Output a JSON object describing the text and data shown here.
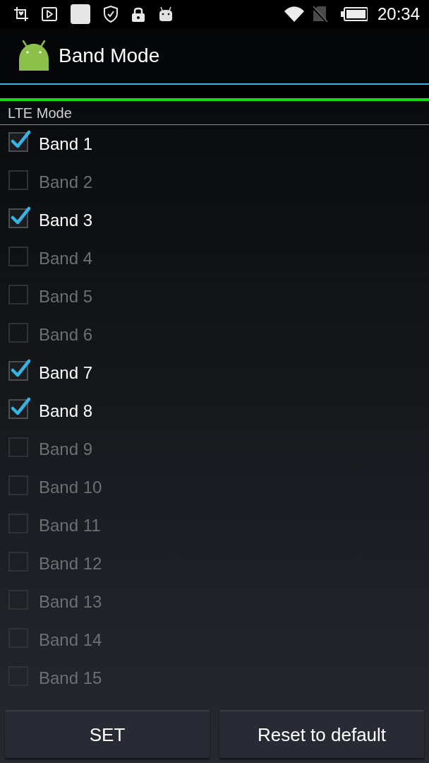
{
  "status_bar": {
    "notification_icons": [
      {
        "kind": "crop"
      },
      {
        "kind": "play"
      },
      {
        "kind": "square"
      },
      {
        "kind": "shield"
      },
      {
        "kind": "lock"
      },
      {
        "kind": "robot"
      }
    ],
    "system_icons": [
      {
        "kind": "wifi"
      },
      {
        "kind": "nosim"
      },
      {
        "kind": "battery"
      }
    ],
    "time": "20:34"
  },
  "app_bar": {
    "title": "Band Mode"
  },
  "section": {
    "title": "LTE Mode"
  },
  "bands": [
    {
      "label": "Band 1",
      "checked": true,
      "disabled": false
    },
    {
      "label": "Band 2",
      "checked": false,
      "disabled": true
    },
    {
      "label": "Band 3",
      "checked": true,
      "disabled": false
    },
    {
      "label": "Band 4",
      "checked": false,
      "disabled": true
    },
    {
      "label": "Band 5",
      "checked": false,
      "disabled": true
    },
    {
      "label": "Band 6",
      "checked": false,
      "disabled": true
    },
    {
      "label": "Band 7",
      "checked": true,
      "disabled": false
    },
    {
      "label": "Band 8",
      "checked": true,
      "disabled": false
    },
    {
      "label": "Band 9",
      "checked": false,
      "disabled": true
    },
    {
      "label": "Band 10",
      "checked": false,
      "disabled": true
    },
    {
      "label": "Band 11",
      "checked": false,
      "disabled": true
    },
    {
      "label": "Band 12",
      "checked": false,
      "disabled": true
    },
    {
      "label": "Band 13",
      "checked": false,
      "disabled": true
    },
    {
      "label": "Band 14",
      "checked": false,
      "disabled": true
    },
    {
      "label": "Band 15",
      "checked": false,
      "disabled": true
    }
  ],
  "buttons": [
    {
      "label": "SET"
    },
    {
      "label": "Reset to default"
    }
  ]
}
